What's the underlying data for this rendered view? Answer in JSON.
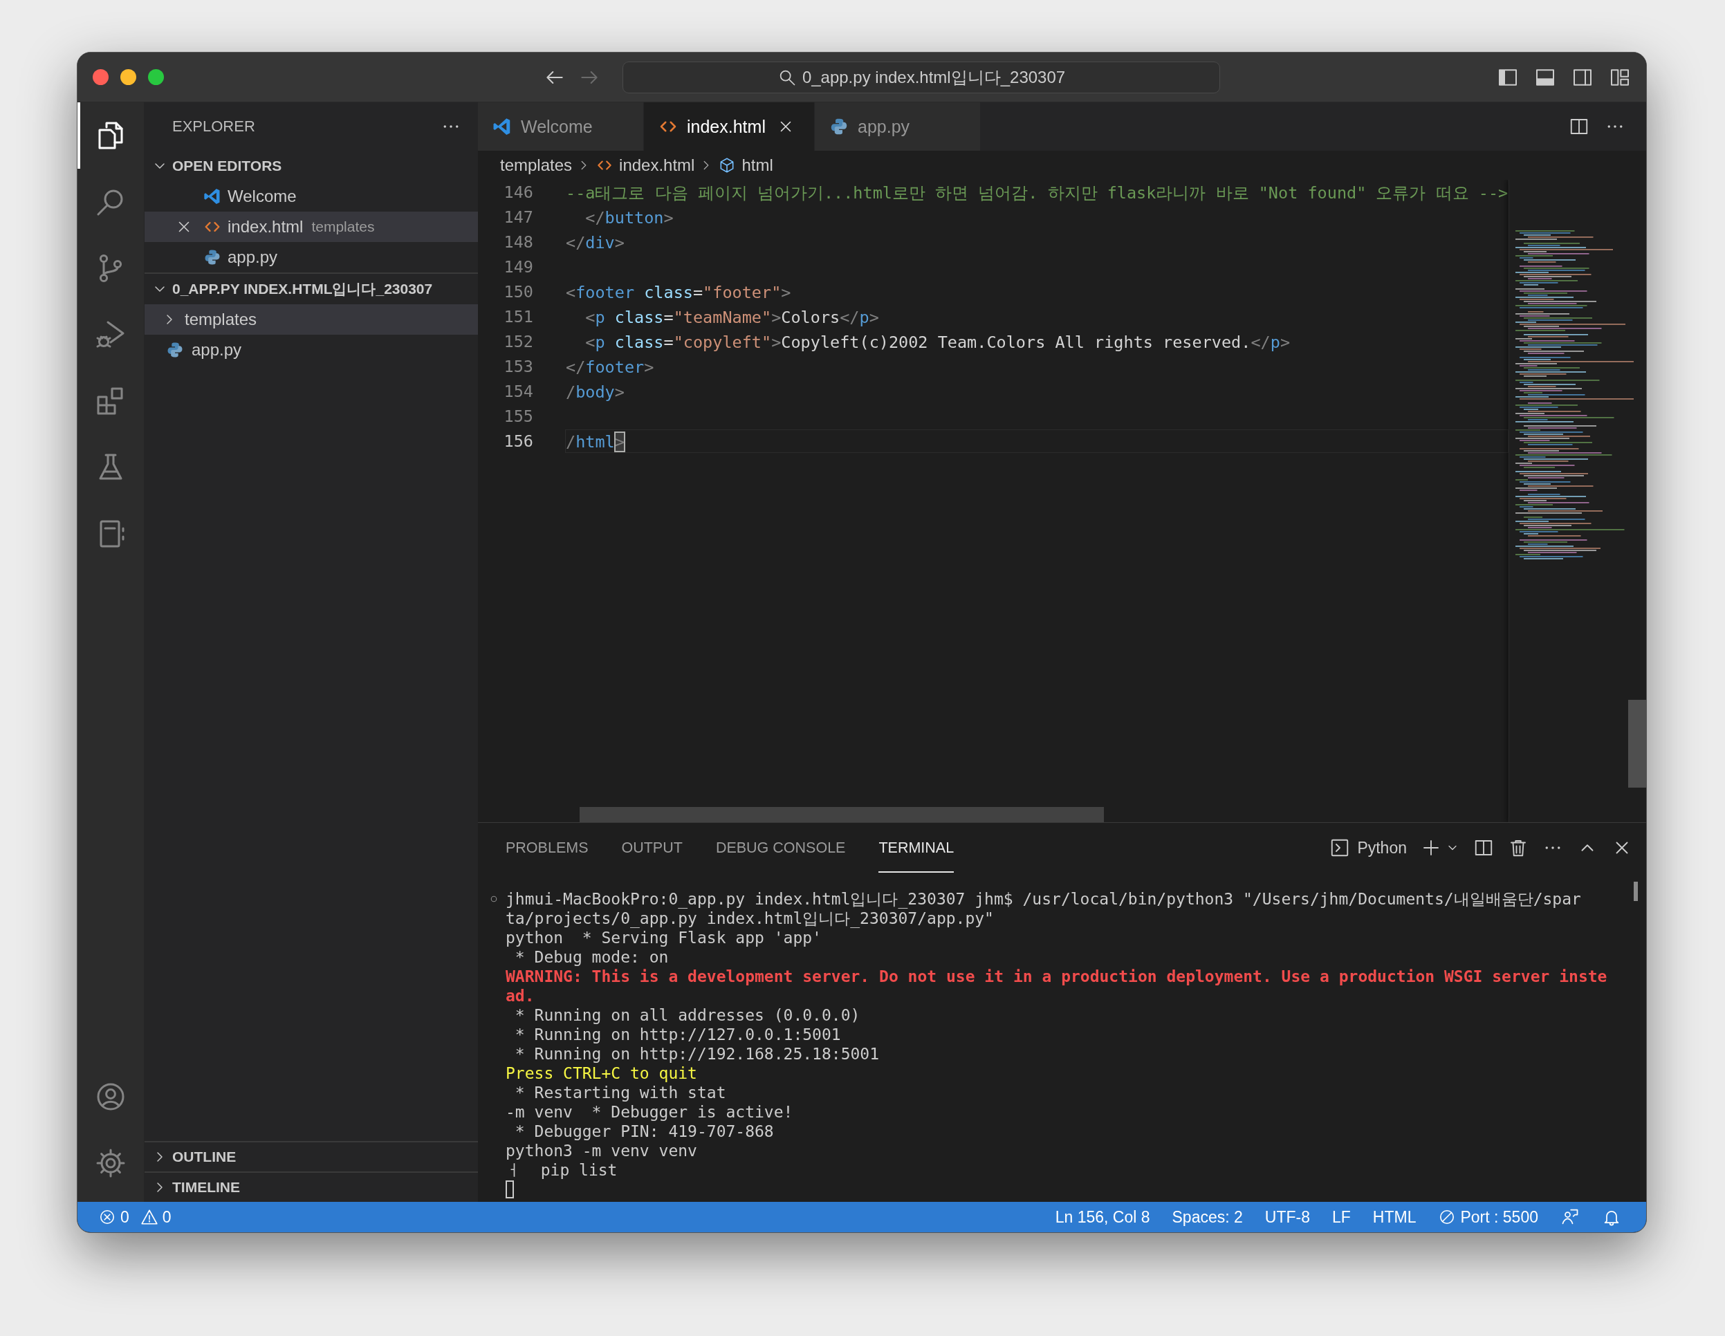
{
  "title_bar": {
    "navigation": [
      {
        "kind": "back",
        "disabled": false
      },
      {
        "kind": "forward",
        "disabled": true
      }
    ],
    "search": "0_app.py index.html입니다_230307",
    "layout_toggles": [
      {
        "kind": "primary_sidebar",
        "on": true
      },
      {
        "kind": "panel",
        "on": true
      },
      {
        "kind": "secondary_sidebar",
        "on": false
      },
      {
        "kind": "customize"
      }
    ]
  },
  "activity_bar": {
    "items": [
      {
        "kind": "explorer",
        "selected": true
      },
      {
        "kind": "search",
        "selected": false
      },
      {
        "kind": "source_control",
        "selected": false
      },
      {
        "kind": "run_debug",
        "selected": false
      },
      {
        "kind": "extensions",
        "selected": false
      },
      {
        "kind": "testing",
        "selected": false
      },
      {
        "kind": "notebook",
        "selected": false
      }
    ],
    "bottom": [
      {
        "kind": "accounts"
      },
      {
        "kind": "manage"
      }
    ]
  },
  "sidebar": {
    "title": "EXPLORER",
    "sections": [
      {
        "title": "OPEN EDITORS",
        "expanded": true,
        "items": [
          {
            "label": "Welcome",
            "kind": "vscode",
            "selected": false
          },
          {
            "label": "index.html",
            "description": "templates",
            "kind": "html",
            "selected": true
          },
          {
            "label": "app.py",
            "kind": "python",
            "selected": false
          }
        ]
      },
      {
        "title": "0_APP.PY INDEX.HTML입니다_230307",
        "expanded": true,
        "items": [
          {
            "label": "templates",
            "kind": "folder",
            "expanded": false,
            "selected": true
          },
          {
            "label": "app.py",
            "kind": "python",
            "selected": false
          }
        ]
      }
    ],
    "bottom_sections": [
      {
        "title": "OUTLINE",
        "expanded": false
      },
      {
        "title": "TIMELINE",
        "expanded": false
      }
    ]
  },
  "editor": {
    "tabs": [
      {
        "label": "Welcome",
        "kind": "vscode",
        "selected": false
      },
      {
        "label": "index.html",
        "kind": "html",
        "selected": true
      },
      {
        "label": "app.py",
        "kind": "python",
        "selected": false
      }
    ],
    "breadcrumb": [
      {
        "label": "templates",
        "kind": "folder"
      },
      {
        "label": "index.html",
        "kind": "html"
      },
      {
        "label": "html",
        "kind": "element"
      }
    ],
    "lines": [
      {
        "number": "146",
        "current": false,
        "tokens": [
          {
            "text": "--a태그로 다음 페이지 넘어가기...html로만 하면 넘어감. 하지만 flask라니까 바로 \"Not found\" 오류가 떠요 -->",
            "kind": "comment"
          }
        ]
      },
      {
        "number": "147",
        "current": false,
        "tokens": [
          {
            "text": "  </",
            "kind": "punct"
          },
          {
            "text": "button",
            "kind": "tag"
          },
          {
            "text": ">",
            "kind": "punct"
          }
        ]
      },
      {
        "number": "148",
        "current": false,
        "tokens": [
          {
            "text": "</",
            "kind": "punct"
          },
          {
            "text": "div",
            "kind": "tag"
          },
          {
            "text": ">",
            "kind": "punct"
          }
        ]
      },
      {
        "number": "149",
        "current": false
      },
      {
        "number": "150",
        "current": false,
        "tokens": [
          {
            "text": "<",
            "kind": "punct"
          },
          {
            "text": "footer",
            "kind": "tag"
          },
          {
            "text": " class",
            "kind": "attr"
          },
          {
            "text": "=",
            "kind": "text"
          },
          {
            "text": "\"footer\"",
            "kind": "string"
          },
          {
            "text": ">",
            "kind": "punct"
          }
        ]
      },
      {
        "number": "151",
        "current": false,
        "tokens": [
          {
            "text": "  <",
            "kind": "punct"
          },
          {
            "text": "p",
            "kind": "tag"
          },
          {
            "text": " class",
            "kind": "attr"
          },
          {
            "text": "=",
            "kind": "text"
          },
          {
            "text": "\"teamName\"",
            "kind": "string"
          },
          {
            "text": ">",
            "kind": "punct"
          },
          {
            "text": "Colors",
            "kind": "text"
          },
          {
            "text": "</",
            "kind": "punct"
          },
          {
            "text": "p",
            "kind": "tag"
          },
          {
            "text": ">",
            "kind": "punct"
          }
        ]
      },
      {
        "number": "152",
        "current": false,
        "tokens": [
          {
            "text": "  <",
            "kind": "punct"
          },
          {
            "text": "p",
            "kind": "tag"
          },
          {
            "text": " class",
            "kind": "attr"
          },
          {
            "text": "=",
            "kind": "text"
          },
          {
            "text": "\"copyleft\"",
            "kind": "string"
          },
          {
            "text": ">",
            "kind": "punct"
          },
          {
            "text": "Copyleft(c)2002 Team.Colors All rights reserved.",
            "kind": "text"
          },
          {
            "text": "</",
            "kind": "punct"
          },
          {
            "text": "p",
            "kind": "tag"
          },
          {
            "text": ">",
            "kind": "punct"
          }
        ]
      },
      {
        "number": "153",
        "current": false,
        "tokens": [
          {
            "text": "</",
            "kind": "punct"
          },
          {
            "text": "footer",
            "kind": "tag"
          },
          {
            "text": ">",
            "kind": "punct"
          }
        ]
      },
      {
        "number": "154",
        "current": false,
        "tokens": [
          {
            "text": "/",
            "kind": "punct"
          },
          {
            "text": "body",
            "kind": "tag"
          },
          {
            "text": ">",
            "kind": "punct"
          }
        ]
      },
      {
        "number": "155",
        "current": false
      },
      {
        "number": "156",
        "current": true,
        "tokens": [
          {
            "text": "/",
            "kind": "punct"
          },
          {
            "text": "html",
            "kind": "tag"
          },
          {
            "text": ">",
            "kind": "punct",
            "cursor": true
          }
        ]
      }
    ]
  },
  "panel": {
    "tabs": [
      {
        "label": "PROBLEMS",
        "selected": false
      },
      {
        "label": "OUTPUT",
        "selected": false
      },
      {
        "label": "DEBUG CONSOLE",
        "selected": false
      },
      {
        "label": "TERMINAL",
        "selected": true
      }
    ],
    "profile": "Python",
    "terminal": {
      "cursor": true,
      "lines": [
        {
          "kind": "command",
          "text": "jhmui-MacBookPro:0_app.py index.html입니다_230307 jhm$ /usr/local/bin/python3 \"/Users/jhm/Documents/내일배움단/spar"
        },
        {
          "kind": "normal",
          "text": "ta/projects/0_app.py index.html입니다_230307/app.py\""
        },
        {
          "kind": "normal",
          "text": "python  * Serving Flask app 'app'"
        },
        {
          "kind": "normal",
          "text": " * Debug mode: on"
        },
        {
          "kind": "warning",
          "text": "WARNING: This is a development server. Do not use it in a production deployment. Use a production WSGI server inste"
        },
        {
          "kind": "warning",
          "text": "ad."
        },
        {
          "kind": "normal",
          "text": " * Running on all addresses (0.0.0.0)"
        },
        {
          "kind": "normal",
          "text": " * Running on http://127.0.0.1:5001"
        },
        {
          "kind": "normal",
          "text": " * Running on http://192.168.25.18:5001"
        },
        {
          "kind": "notice",
          "text": "Press CTRL+C to quit"
        },
        {
          "kind": "normal",
          "text": " * Restarting with stat"
        },
        {
          "kind": "normal",
          "text": "-m venv  * Debugger is active!"
        },
        {
          "kind": "normal",
          "text": " * Debugger PIN: 419-707-868"
        },
        {
          "kind": "normal",
          "text": "python3 -m venv venv"
        },
        {
          "kind": "normal",
          "text": "ㅓ  pip list"
        }
      ]
    }
  },
  "status_bar": {
    "problems": [
      {
        "kind": "error",
        "count": "0"
      },
      {
        "kind": "warning",
        "count": "0"
      }
    ],
    "items": [
      {
        "kind": "text",
        "text": "Ln 156, Col 8"
      },
      {
        "kind": "text",
        "text": "Spaces: 2"
      },
      {
        "kind": "text",
        "text": "UTF-8"
      },
      {
        "kind": "text",
        "text": "LF"
      },
      {
        "kind": "text",
        "text": "HTML"
      },
      {
        "kind": "port",
        "text": "Port : 5500"
      },
      {
        "kind": "feedback"
      },
      {
        "kind": "bell"
      }
    ]
  }
}
